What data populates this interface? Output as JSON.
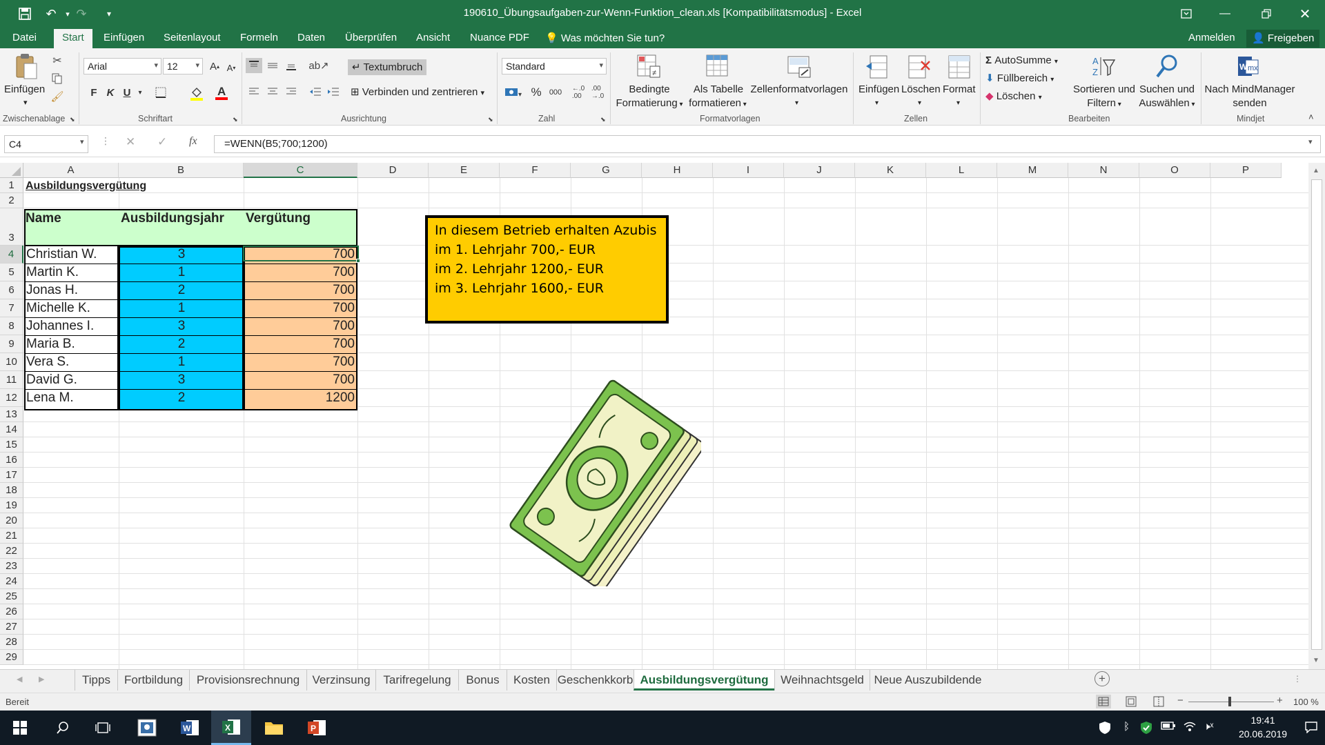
{
  "window": {
    "title": "190610_Übungsaufgaben-zur-Wenn-Funktion_clean.xls  [Kompatibilitätsmodus] - Excel",
    "theme_color": "#217346"
  },
  "quick_access": {
    "save_icon": "save-icon",
    "undo_icon": "undo-icon",
    "redo_icon": "redo-icon",
    "customize_icon": "customize-qat-icon"
  },
  "ribbon_tabs": [
    {
      "label": "Datei"
    },
    {
      "label": "Start"
    },
    {
      "label": "Einfügen"
    },
    {
      "label": "Seitenlayout"
    },
    {
      "label": "Formeln"
    },
    {
      "label": "Daten"
    },
    {
      "label": "Überprüfen"
    },
    {
      "label": "Ansicht"
    },
    {
      "label": "Nuance PDF"
    }
  ],
  "tell_me": "Was möchten Sie tun?",
  "account": {
    "signin": "Anmelden",
    "share": "Freigeben"
  },
  "ribbon": {
    "clipboard": {
      "paste": "Einfügen",
      "label": "Zwischenablage"
    },
    "font": {
      "name": "Arial",
      "size": "12",
      "bold": "F",
      "italic": "K",
      "underline": "U",
      "label": "Schriftart"
    },
    "alignment": {
      "wrap": "Textumbruch",
      "merge": "Verbinden und zentrieren",
      "label": "Ausrichtung"
    },
    "number": {
      "format": "Standard",
      "percent": "%",
      "thousands": "000",
      "label": "Zahl"
    },
    "styles": {
      "conditional_1": "Bedingte",
      "conditional_2": "Formatierung",
      "table_1": "Als Tabelle",
      "table_2": "formatieren",
      "cellstyles": "Zellenformatvorlagen",
      "label": "Formatvorlagen"
    },
    "cells": {
      "insert": "Einfügen",
      "delete": "Löschen",
      "format": "Format",
      "label": "Zellen"
    },
    "editing": {
      "autosum": "AutoSumme",
      "fill": "Füllbereich",
      "clear": "Löschen",
      "sort_1": "Sortieren und",
      "sort_2": "Filtern",
      "find_1": "Suchen und",
      "find_2": "Auswählen",
      "label": "Bearbeiten"
    },
    "mindjet": {
      "send_1": "Nach MindManager",
      "send_2": "senden",
      "label": "Mindjet"
    }
  },
  "formula_bar": {
    "name_box": "C4",
    "fx": "fx",
    "formula": "=WENN(B5;700;1200)"
  },
  "columns": [
    "A",
    "B",
    "C",
    "D",
    "E",
    "F",
    "G",
    "H",
    "I",
    "J",
    "K",
    "L",
    "M",
    "N",
    "O",
    "P"
  ],
  "rows": [
    "1",
    "2",
    "3",
    "4",
    "5",
    "6",
    "7",
    "8",
    "9",
    "10",
    "11",
    "12",
    "13",
    "14",
    "15",
    "16",
    "17",
    "18",
    "19",
    "20",
    "21",
    "22",
    "23",
    "24",
    "25",
    "26",
    "27",
    "28",
    "29"
  ],
  "sheet": {
    "title": "Ausbildungsvergütung",
    "headers": [
      "Name",
      "Ausbildungsjahr",
      "Vergütung"
    ],
    "data": [
      {
        "name": "Christian W.",
        "year": "3",
        "pay": "700"
      },
      {
        "name": "Martin K.",
        "year": "1",
        "pay": "700"
      },
      {
        "name": "Jonas H.",
        "year": "2",
        "pay": "700"
      },
      {
        "name": "Michelle K.",
        "year": "1",
        "pay": "700"
      },
      {
        "name": "Johannes I.",
        "year": "3",
        "pay": "700"
      },
      {
        "name": "Maria B.",
        "year": "2",
        "pay": "700"
      },
      {
        "name": "Vera S.",
        "year": "1",
        "pay": "700"
      },
      {
        "name": "David G.",
        "year": "3",
        "pay": "700"
      },
      {
        "name": "Lena M.",
        "year": "2",
        "pay": "1200"
      }
    ],
    "colors": {
      "header": "#ccffcc",
      "year": "#00ccff",
      "pay": "#ffcc99",
      "note": "#ffcc00"
    }
  },
  "note_box": {
    "lines": [
      "In diesem Betrieb erhalten Azubis",
      "im 1. Lehrjahr 700,-   EUR",
      "im 2. Lehrjahr 1200,- EUR",
      "im 3. Lehrjahr 1600,- EUR"
    ]
  },
  "clipart": "money-stack",
  "sheet_tabs": [
    {
      "label": "Tipps"
    },
    {
      "label": "Fortbildung"
    },
    {
      "label": "Provisionsrechnung"
    },
    {
      "label": "Verzinsung"
    },
    {
      "label": "Tarifregelung"
    },
    {
      "label": "Bonus"
    },
    {
      "label": "Kosten"
    },
    {
      "label": "Geschenkkorb"
    },
    {
      "label": "Ausbildungsvergütung"
    },
    {
      "label": "Weihnachtsgeld"
    },
    {
      "label": "Neue Auszubildende"
    }
  ],
  "status": {
    "ready": "Bereit",
    "zoom": "100 %"
  },
  "taskbar": {
    "time": "19:41",
    "date": "20.06.2019"
  }
}
